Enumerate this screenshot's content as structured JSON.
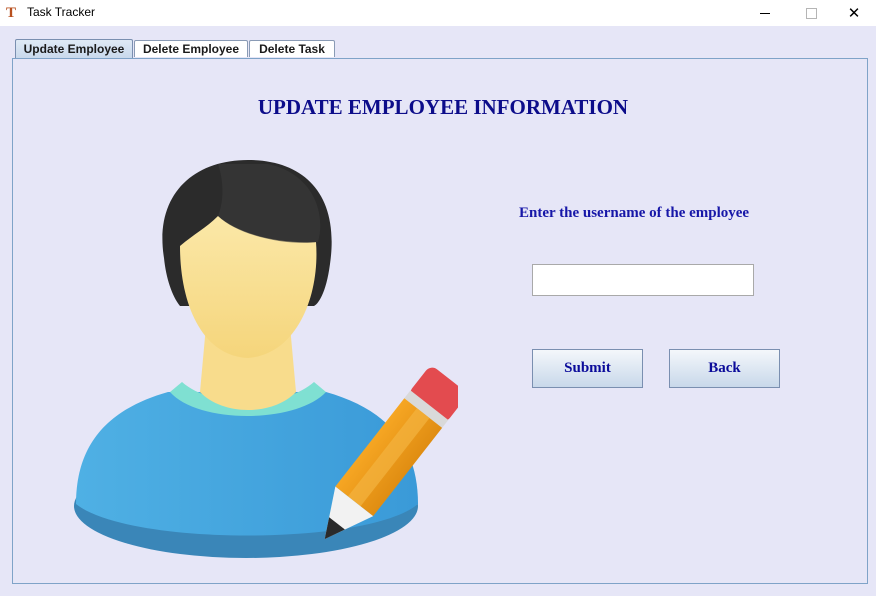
{
  "window": {
    "title": "Task Tracker",
    "app_icon_glyph": "T",
    "controls": {
      "minimize": "minimize-icon",
      "maximize": "maximize-icon",
      "close": "close-icon",
      "close_glyph": "✕"
    }
  },
  "tabs": [
    {
      "label": "Update Employee",
      "active": true
    },
    {
      "label": "Delete Employee",
      "active": false
    },
    {
      "label": "Delete Task",
      "active": false
    }
  ],
  "main": {
    "heading": "UPDATE EMPLOYEE INFORMATION",
    "prompt": "Enter the username of the employee",
    "username_input": {
      "value": "",
      "placeholder": ""
    },
    "submit_label": "Submit",
    "back_label": "Back",
    "illustration": "employee-edit-icon"
  },
  "colors": {
    "background": "#e6e6f7",
    "heading": "#0c0c8a",
    "prompt": "#1717a8",
    "button_text": "#0b0b9a"
  }
}
